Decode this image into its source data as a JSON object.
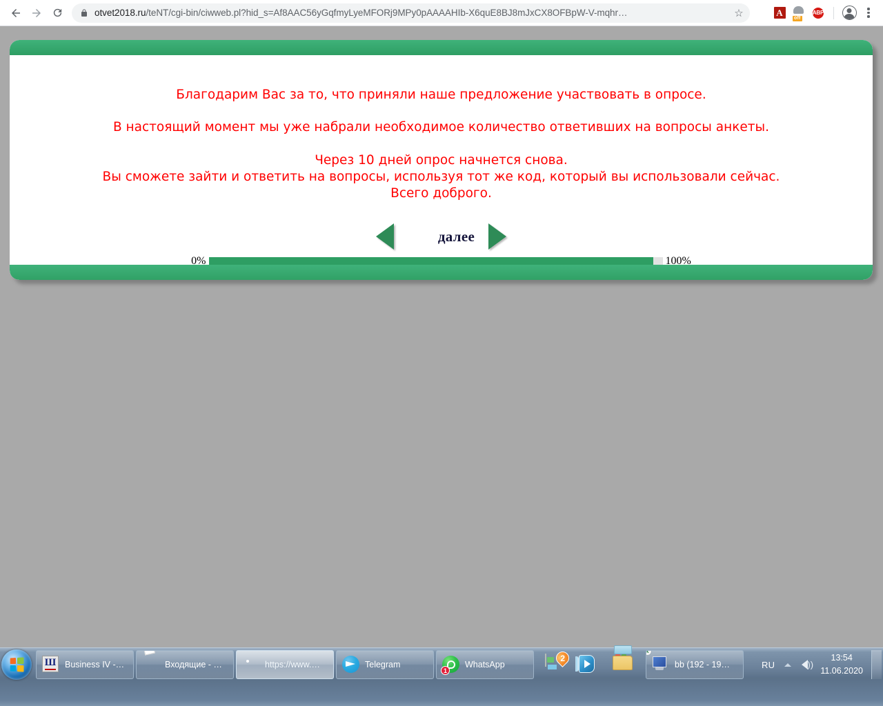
{
  "browser": {
    "back_label": "←",
    "forward_label": "→",
    "reload_label": "⟳",
    "url_domain": "otvet2018.ru",
    "url_path": "/teNT/cgi-bin/ciwweb.pl?hid_s=Af8AAC56yGqfmyLyeMFORj9MPy0pAAAAHIb-X6quE8BJ8mJxCX8OFBpW-V-mqhr…",
    "star_label": "☆",
    "extensions": [
      {
        "name": "adobe-acrobat-extension",
        "label": "A"
      },
      {
        "name": "ghostery-extension",
        "label": "off"
      },
      {
        "name": "adblock-plus-extension",
        "label": "ABP"
      }
    ],
    "profile_label": "",
    "menu_label": ""
  },
  "survey": {
    "accent_color": "#2e9e63",
    "text_color": "#ff0000",
    "lines": [
      "Благодарим Вас за то, что приняли наше предложение участвовать в опросе.",
      "В настоящий момент мы уже набрали необходимое количество ответивших на вопросы анкеты.",
      "Через 10 дней опрос начнется снова.",
      "Вы сможете зайти и ответить на вопросы, используя тот же код, который вы использовали сейчас.",
      "Всего доброго."
    ],
    "nav": {
      "prev_label": "",
      "next_label": "далее"
    },
    "progress": {
      "min_label": "0%",
      "max_label": "100%",
      "value": 98
    }
  },
  "taskbar": {
    "start_label": "",
    "tasks": [
      {
        "name": "business-iv",
        "label": "Business IV -…",
        "icon": "business-icon",
        "active": false
      },
      {
        "name": "mail-inbox",
        "label": "Входящие - …",
        "icon": "mail-icon",
        "active": false
      },
      {
        "name": "chrome-window",
        "label": "https://www.…",
        "icon": "chrome-icon",
        "active": true
      },
      {
        "name": "telegram",
        "label": "Telegram",
        "icon": "telegram-icon",
        "active": false
      },
      {
        "name": "whatsapp",
        "label": "WhatsApp",
        "icon": "whatsapp-icon",
        "active": false,
        "badge": "1"
      },
      {
        "name": "remote-desktop",
        "label": "bb (192 - 19…",
        "icon": "monitor-icon",
        "active": false
      }
    ],
    "pinned": [
      {
        "name": "maps-app",
        "badge": "2"
      },
      {
        "name": "media-player-app"
      },
      {
        "name": "file-explorer-app"
      }
    ],
    "tray": {
      "language": "RU",
      "time": "13:54",
      "date": "11.06.2020"
    }
  }
}
